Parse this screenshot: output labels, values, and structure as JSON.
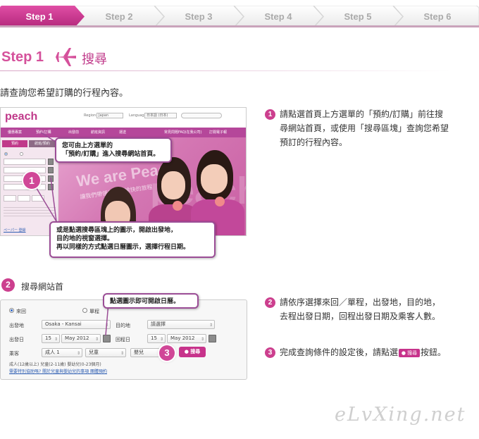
{
  "steps": [
    "Step 1",
    "Step 2",
    "Step 3",
    "Step 4",
    "Step 5",
    "Step 6"
  ],
  "active_step": 0,
  "colors": {
    "accent": "#c0398a",
    "stepbar_active": "#c7338b",
    "stepbar_inactive": "#f2f2f2"
  },
  "heading": {
    "step": "Step 1",
    "title": "搜尋",
    "icon": "airplane-icon"
  },
  "intro": "請查詢您希望訂購的行程內容。",
  "shot1": {
    "logo": "peach",
    "region_label": "Region:",
    "region_value": "Japan",
    "language_label": "Language:",
    "language_value": "日本語 (日本)",
    "nav_items": [
      "優惠專案",
      "預約/訂購",
      "出發前",
      "航班資訊",
      "運送",
      "常見問題FAQ(在我公司)",
      "訂閱電子報"
    ],
    "panel_tabs": [
      "預約",
      "航班/預約"
    ],
    "hero_text": "We are Peach",
    "hero_sub": "讓我們帶領您展開愉快的旅程",
    "panel_link": "ペーパー 登録"
  },
  "callouts": {
    "top": "您可由上方選單的「預約/訂購」進入搜尋網站首頁。",
    "top_line1": "您可由上方選單的",
    "top_line2": "「預約/訂購」進入搜尋網站首頁。",
    "bottom_line1": "或是點選搜尋區塊上的圖示，開啟出發地，",
    "bottom_line2": "目的地的視窗選擇。",
    "bottom_line3": "再以同樣的方式點選日曆圖示，選擇行程日期。",
    "calendar": "點選圖示即可開啟日曆。"
  },
  "badges": [
    "1",
    "2",
    "3"
  ],
  "right_desc": {
    "p1_line1": "請點選首頁上方選單的「預約/訂購」前往搜",
    "p1_line2": "尋網站首頁，或使用「搜尋區塊」查詢您希望",
    "p1_line3": "預訂的行程內容。",
    "p2_line1": "請依序選擇來回／單程，出發地，目的地，",
    "p2_line2": "去程出發日期，回程出發日期及乘客人數。",
    "p3_before": "完成查詢條件的設定後，請點選",
    "p3_btn": "搜尋",
    "p3_after": "按鈕。"
  },
  "section2": {
    "title": "搜尋網站首",
    "trip_roundtrip": "來回",
    "trip_oneway": "單程",
    "origin_label": "出發地",
    "origin_value": "Osaka - Kansai",
    "dest_label": "目的地",
    "dest_value": "請選擇",
    "depart_label": "出發日",
    "depart_day": "15",
    "depart_month": "May 2012",
    "return_label": "回程日",
    "return_day": "15",
    "return_month": "May 2012",
    "pax_label": "乘客",
    "adult": "成人 1",
    "child": "兒童",
    "infant": "嬰兒",
    "search_btn": "搜尋",
    "note": "成人(12歲以上) 兒童(2-11歲) 嬰幼兒(0-23個月)",
    "links": "需要特別協助嗎? 關於兒童與嬰幼兒的事項 團體預約"
  },
  "watermark": "eLvXing.net"
}
